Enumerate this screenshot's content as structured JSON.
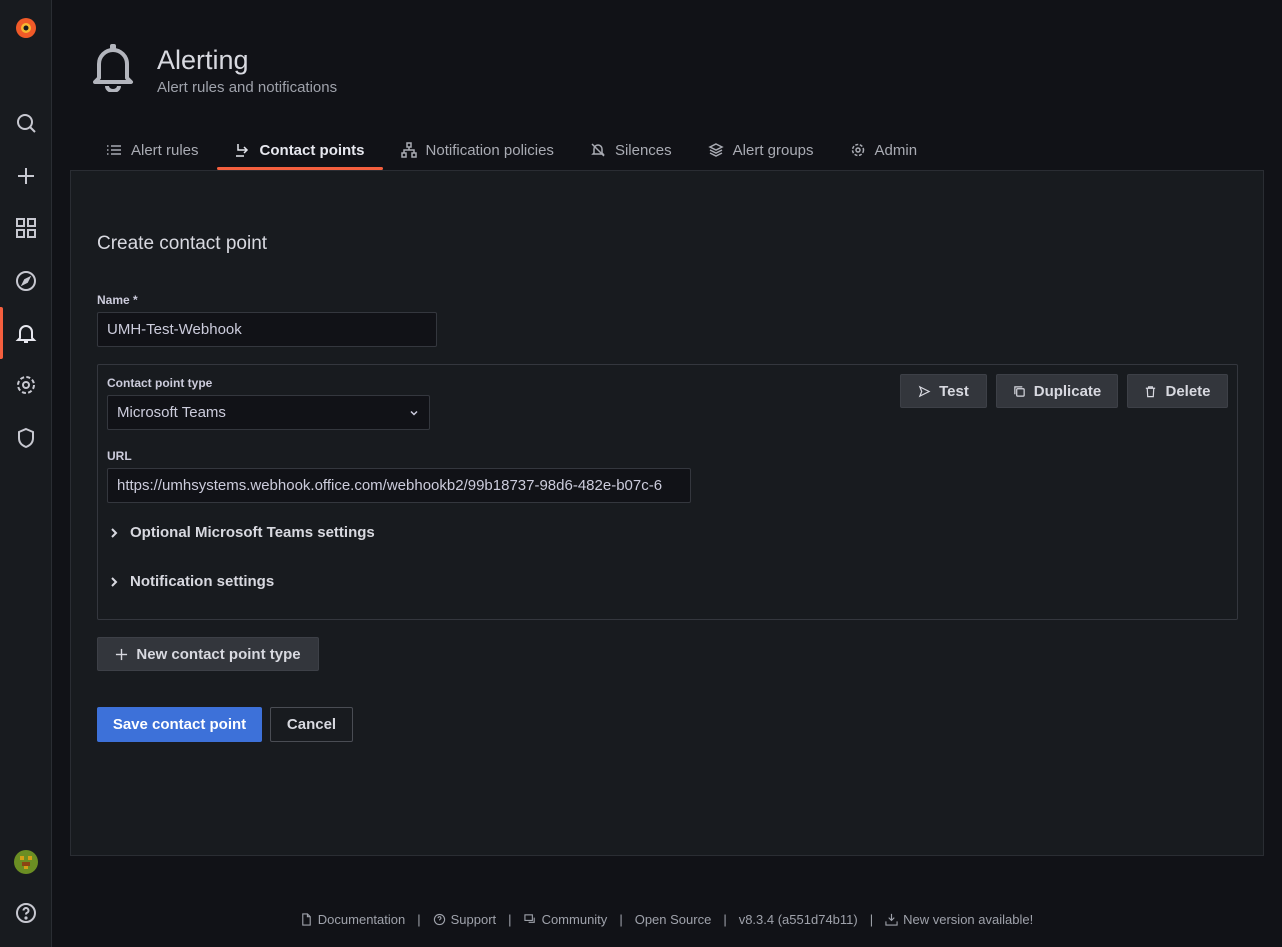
{
  "header": {
    "title": "Alerting",
    "subtitle": "Alert rules and notifications"
  },
  "tabs": [
    {
      "label": "Alert rules",
      "icon": "list-icon"
    },
    {
      "label": "Contact points",
      "icon": "comment-alt-share-icon",
      "active": true
    },
    {
      "label": "Notification policies",
      "icon": "sitemap-icon"
    },
    {
      "label": "Silences",
      "icon": "bell-slash-icon"
    },
    {
      "label": "Alert groups",
      "icon": "layer-group-icon"
    },
    {
      "label": "Admin",
      "icon": "cog-icon"
    }
  ],
  "form": {
    "title": "Create contact point",
    "name_label": "Name *",
    "name_value": "UMH-Test-Webhook",
    "type_label": "Contact point type",
    "type_value": "Microsoft Teams",
    "url_label": "URL",
    "url_value": "https://umhsystems.webhook.office.com/webhookb2/99b18737-98d6-482e-b07c-6",
    "test_label": "Test",
    "duplicate_label": "Duplicate",
    "delete_label": "Delete",
    "optional_settings_label": "Optional Microsoft Teams settings",
    "notification_settings_label": "Notification settings",
    "new_type_label": "New contact point type",
    "save_label": "Save contact point",
    "cancel_label": "Cancel"
  },
  "footer": {
    "documentation": "Documentation",
    "support": "Support",
    "community": "Community",
    "open_source": "Open Source",
    "version": "v8.3.4 (a551d74b11)",
    "new_version": "New version available!",
    "separator": "|"
  },
  "colors": {
    "accent": "#f55f3e",
    "primary": "#3d71d9",
    "background": "#111217",
    "panel": "#181b1f"
  }
}
